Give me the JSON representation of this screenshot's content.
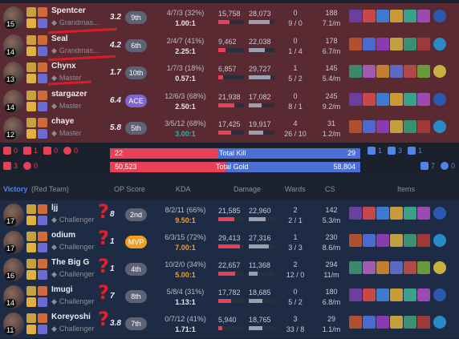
{
  "red_team": [
    {
      "name": "Spentcer",
      "rank": "Grandmas...",
      "level": "15",
      "score": "3.2",
      "badge": "9th",
      "kda_line": "4/7/3 (32%)",
      "kda_ratio": "1.00:1",
      "dmg_dealt": "15,758",
      "dmg_taken": "28,073",
      "dealt_pct": 0.45,
      "taken_pct": 0.8,
      "wards_top": "0",
      "wards_bot": "9 / 0",
      "cs_top": "188",
      "cs_bot": "7.1/m"
    },
    {
      "name": "Seal",
      "rank": "Grandmas...",
      "level": "14",
      "score": "4.2",
      "badge": "6th",
      "kda_line": "2/4/7 (41%)",
      "kda_ratio": "2.25:1",
      "dmg_dealt": "9,462",
      "dmg_taken": "22,038",
      "dealt_pct": 0.27,
      "taken_pct": 0.62,
      "wards_top": "0",
      "wards_bot": "1 / 4",
      "cs_top": "178",
      "cs_bot": "6.7/m"
    },
    {
      "name": "Chynx",
      "rank": "Master",
      "level": "13",
      "score": "1.7",
      "badge": "10th",
      "kda_line": "1/7/3 (18%)",
      "kda_ratio": "0.57:1",
      "dmg_dealt": "6,857",
      "dmg_taken": "29,727",
      "dealt_pct": 0.2,
      "taken_pct": 0.85,
      "wards_top": "1",
      "wards_bot": "5 / 2",
      "cs_top": "145",
      "cs_bot": "5.4/m"
    },
    {
      "name": "stargazer",
      "rank": "Master",
      "level": "14",
      "score": "6.4",
      "badge": "ACE",
      "kda_line": "12/6/3 (68%)",
      "kda_ratio": "2.50:1",
      "dmg_dealt": "21,938",
      "dmg_taken": "17,082",
      "dealt_pct": 0.63,
      "taken_pct": 0.49,
      "wards_top": "0",
      "wards_bot": "8 / 1",
      "cs_top": "245",
      "cs_bot": "9.2/m"
    },
    {
      "name": "chaye",
      "rank": "Master",
      "level": "12",
      "score": "5.8",
      "badge": "5th",
      "kda_line": "3/5/12 (68%)",
      "kda_ratio": "3.00:1",
      "dmg_dealt": "17,425",
      "dmg_taken": "19,917",
      "dealt_pct": 0.5,
      "taken_pct": 0.57,
      "wards_top": "4",
      "wards_bot": "26 / 10",
      "cs_top": "31",
      "cs_bot": "1.2/m"
    }
  ],
  "summary": {
    "red_obj": [
      "0",
      "1",
      "0",
      "0",
      "3",
      "0"
    ],
    "blue_obj": [
      "1",
      "3",
      "1",
      "7",
      "0"
    ],
    "kill_left": "22",
    "kill_label": "Total Kill",
    "kill_right": "29",
    "kill_red_pct": 0.43,
    "gold_left": "50,523",
    "gold_label": "Total Gold",
    "gold_right": "58,804",
    "gold_red_pct": 0.46
  },
  "header": {
    "victory": "Victory",
    "team": "(Red Team)",
    "op_score": "OP Score",
    "kda": "KDA",
    "damage": "Damage",
    "wards": "Wards",
    "cs": "CS",
    "items": "Items"
  },
  "blue_team": [
    {
      "name": "ljj",
      "rank": "Challenger",
      "level": "17",
      "score": "8",
      "badge": "2nd",
      "kda_line": "8/2/11 (66%)",
      "kda_ratio": "9.50:1",
      "dmg_dealt": "21,585",
      "dmg_taken": "22,960",
      "dealt_pct": 0.62,
      "taken_pct": 0.66,
      "wards_top": "2",
      "wards_bot": "2 / 1",
      "cs_top": "142",
      "cs_bot": "5.3/m"
    },
    {
      "name": "odium",
      "rank": "Challenger",
      "level": "17",
      "score": "1",
      "badge": "MVP",
      "kda_line": "6/3/15 (72%)",
      "kda_ratio": "7.00:1",
      "dmg_dealt": "29,413",
      "dmg_taken": "27,316",
      "dealt_pct": 0.85,
      "taken_pct": 0.79,
      "wards_top": "1",
      "wards_bot": "3 / 3",
      "cs_top": "230",
      "cs_bot": "8.6/m"
    },
    {
      "name": "The Big G",
      "rank": "Challenger",
      "level": "16",
      "score": "1",
      "badge": "4th",
      "kda_line": "10/2/0 (34%)",
      "kda_ratio": "5.00:1",
      "dmg_dealt": "22,657",
      "dmg_taken": "11,368",
      "dealt_pct": 0.65,
      "taken_pct": 0.33,
      "wards_top": "2",
      "wards_bot": "12 / 0",
      "cs_top": "294",
      "cs_bot": "11/m"
    },
    {
      "name": "Imugi",
      "rank": "Challenger",
      "level": "14",
      "score": "7",
      "badge": "8th",
      "kda_line": "5/8/4 (31%)",
      "kda_ratio": "1.13:1",
      "dmg_dealt": "17,782",
      "dmg_taken": "18,685",
      "dealt_pct": 0.51,
      "taken_pct": 0.54,
      "wards_top": "0",
      "wards_bot": "5 / 2",
      "cs_top": "180",
      "cs_bot": "6.8/m"
    },
    {
      "name": "Koreyoshi",
      "rank": "Challenger",
      "level": "11",
      "score": "3.8",
      "badge": "7th",
      "kda_line": "0/7/12 (41%)",
      "kda_ratio": "1.71:1",
      "dmg_dealt": "5,940",
      "dmg_taken": "18,765",
      "dealt_pct": 0.17,
      "taken_pct": 0.54,
      "wards_top": "3",
      "wards_bot": "33 / 8",
      "cs_top": "29",
      "cs_bot": "1.1/m"
    }
  ],
  "colors": {
    "loss_row": "#5a2a33",
    "win_row": "#1e2b45",
    "accent_red": "#e84057",
    "accent_blue": "#5383e8",
    "mvp": "#f0a020",
    "ace": "#7b67d1"
  }
}
